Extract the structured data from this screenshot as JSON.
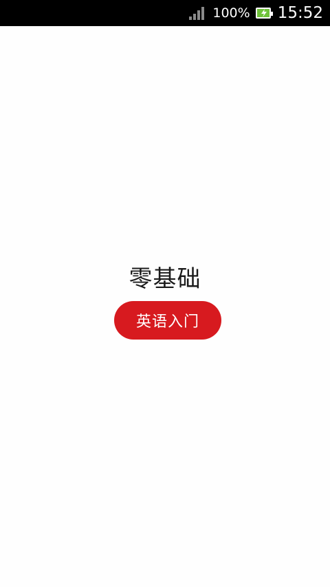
{
  "status_bar": {
    "battery_percent": "100%",
    "time": "15:52",
    "signal_icon": "signal-icon",
    "battery_icon": "battery-charging-icon"
  },
  "main": {
    "headline": "零基础",
    "cta_label": "英语入门",
    "cta_color": "#d71a1f"
  }
}
